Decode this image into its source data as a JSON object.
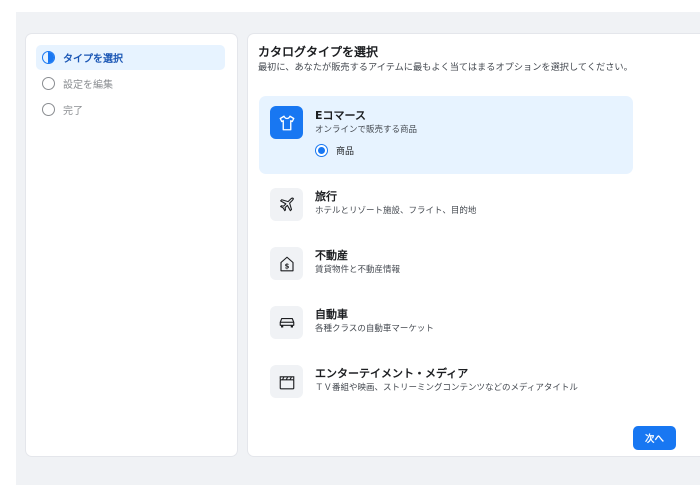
{
  "steps": [
    {
      "label": "タイプを選択",
      "state": "active"
    },
    {
      "label": "設定を編集",
      "state": "pending"
    },
    {
      "label": "完了",
      "state": "pending"
    }
  ],
  "header": {
    "title": "カタログタイプを選択",
    "description": "最初に、あなたが販売するアイテムに最もよく当てはまるオプションを選択してください。"
  },
  "options": [
    {
      "name": "Eコマース",
      "subtitle": "オンラインで販売する商品",
      "icon": "tshirt-icon",
      "selected": true,
      "sub_option": "商品"
    },
    {
      "name": "旅行",
      "subtitle": "ホテルとリゾート施設、フライト、目的地",
      "icon": "airplane-icon",
      "selected": false
    },
    {
      "name": "不動産",
      "subtitle": "賃貸物件と不動産情報",
      "icon": "house-dollar-icon",
      "selected": false
    },
    {
      "name": "自動車",
      "subtitle": "各種クラスの自動車マーケット",
      "icon": "car-icon",
      "selected": false
    },
    {
      "name": "エンターテイメント・メディア",
      "subtitle": "ＴＶ番組や映画、ストリーミングコンテンツなどのメディアタイトル",
      "icon": "clapperboard-icon",
      "selected": false
    }
  ],
  "footer": {
    "next_label": "次へ"
  },
  "colors": {
    "accent": "#1877f2",
    "selected_bg": "#e7f3ff",
    "canvas_bg": "#f0f2f5"
  }
}
